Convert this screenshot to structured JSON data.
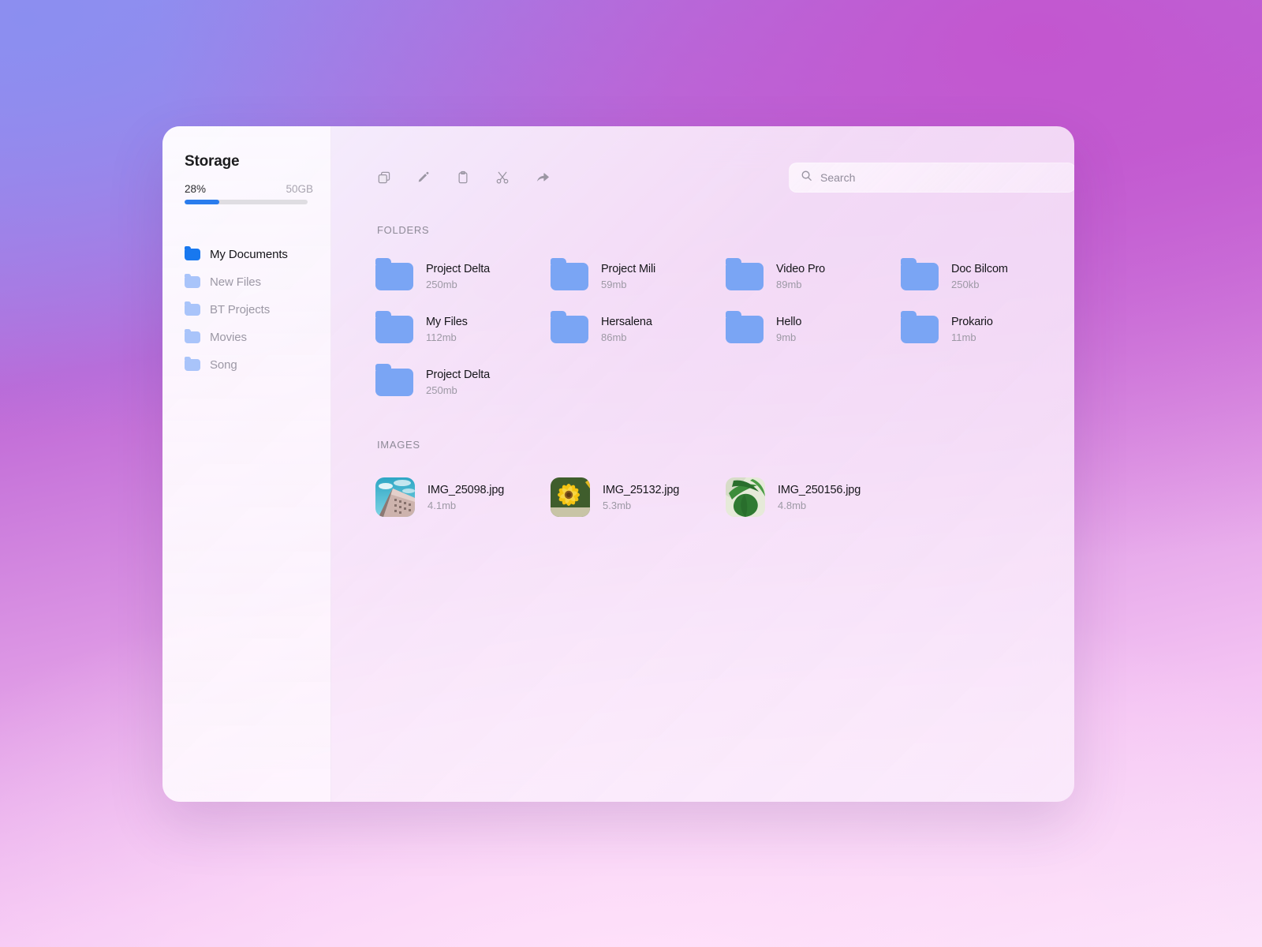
{
  "sidebar": {
    "storage": {
      "title": "Storage",
      "percent_label": "28%",
      "total_label": "50GB",
      "percent_value": 28,
      "bar_color": "#2a7ced"
    },
    "items": [
      {
        "label": "My Documents",
        "active": true,
        "icon": "folder-icon"
      },
      {
        "label": "New Files",
        "active": false,
        "icon": "folder-icon"
      },
      {
        "label": "BT Projects",
        "active": false,
        "icon": "folder-icon"
      },
      {
        "label": "Movies",
        "active": false,
        "icon": "folder-icon"
      },
      {
        "label": "Song",
        "active": false,
        "icon": "folder-icon"
      }
    ]
  },
  "toolbar": {
    "tools": [
      {
        "name": "copy-icon",
        "label": "Copy"
      },
      {
        "name": "edit-icon",
        "label": "Edit"
      },
      {
        "name": "paste-icon",
        "label": "Paste"
      },
      {
        "name": "cut-icon",
        "label": "Cut"
      },
      {
        "name": "share-icon",
        "label": "Share"
      }
    ]
  },
  "search": {
    "placeholder": "Search",
    "value": "",
    "icon": "search-icon"
  },
  "sections": {
    "folders_label": "FOLDERS",
    "images_label": "IMAGES"
  },
  "folders": [
    {
      "name": "Project Delta",
      "size": "250mb"
    },
    {
      "name": "Project Mili",
      "size": "59mb"
    },
    {
      "name": "Video Pro",
      "size": "89mb"
    },
    {
      "name": "Doc Bilcom",
      "size": "250kb"
    },
    {
      "name": "My Files",
      "size": "112mb"
    },
    {
      "name": "Hersalena",
      "size": "86mb"
    },
    {
      "name": "Hello",
      "size": "9mb"
    },
    {
      "name": "Prokario",
      "size": "11mb"
    },
    {
      "name": "Project Delta",
      "size": "250mb"
    }
  ],
  "images": [
    {
      "name": "IMG_25098.jpg",
      "size": "4.1mb",
      "thumb": "building-photo"
    },
    {
      "name": "IMG_25132.jpg",
      "size": "5.3mb",
      "thumb": "sunflower-photo"
    },
    {
      "name": "IMG_250156.jpg",
      "size": "4.8mb",
      "thumb": "leaf-photo"
    }
  ],
  "colors": {
    "accent_blue": "#1878ef",
    "folder_blue": "#7aa5f4",
    "folder_muted": "#a9c4fa",
    "text_primary": "#16161a",
    "text_muted": "#9d99a5"
  }
}
